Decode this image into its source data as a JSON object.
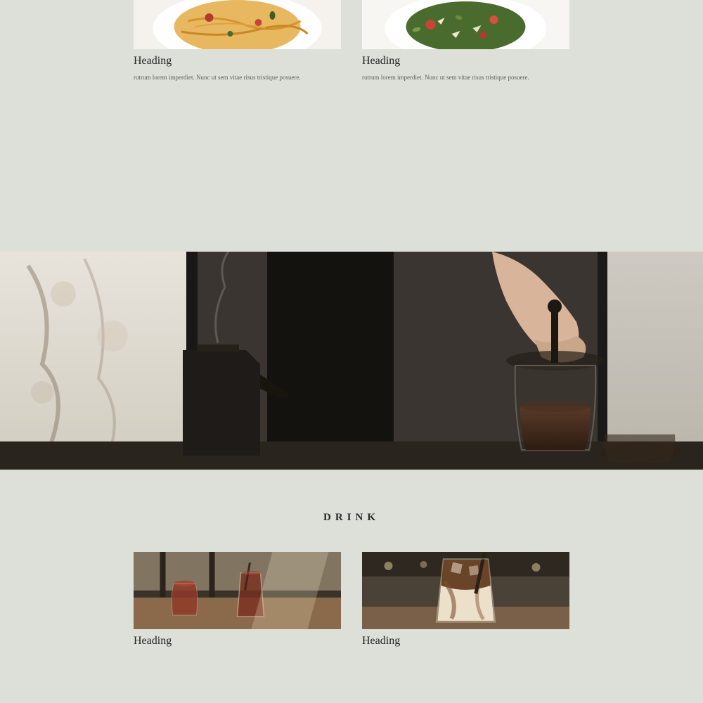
{
  "food_cards": [
    {
      "heading": "Heading",
      "body": "rutrum lorem imperdiet. Nunc ut sem vitae risus tristique posuere."
    },
    {
      "heading": "Heading",
      "body": "rutrum lorem imperdiet. Nunc ut sem vitae risus tristique posuere."
    }
  ],
  "section_title": "DRINK",
  "drink_cards": [
    {
      "heading": "Heading"
    },
    {
      "heading": "Heading"
    }
  ]
}
